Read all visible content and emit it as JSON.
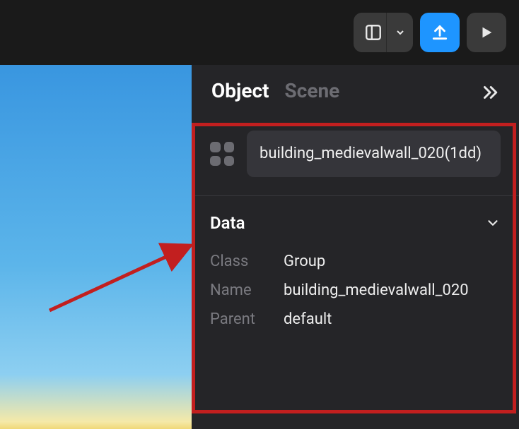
{
  "toolbar": {
    "layout_icon": "layout",
    "chevron_icon": "chevron-down",
    "upload_icon": "upload",
    "play_icon": "play"
  },
  "inspector": {
    "tabs": {
      "object": "Object",
      "scene": "Scene"
    },
    "expand_label": "expand",
    "object_name": "building_medievalwall_020(1dd)",
    "sections": {
      "data": {
        "title": "Data",
        "props": {
          "class_label": "Class",
          "class_value": "Group",
          "name_label": "Name",
          "name_value": "building_medievalwall_020",
          "parent_label": "Parent",
          "parent_value": "default"
        }
      }
    }
  }
}
